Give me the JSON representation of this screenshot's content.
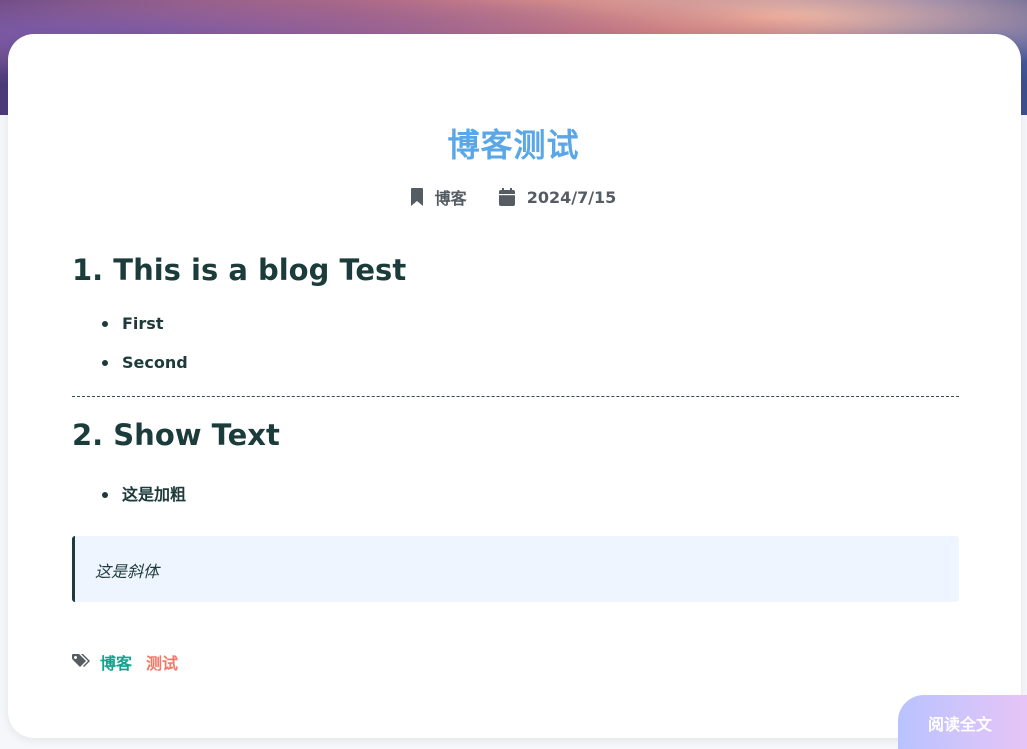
{
  "post": {
    "title": "博客测试",
    "category": "博客",
    "date": "2024/7/15",
    "sections": [
      {
        "heading": "1. This is a blog Test",
        "items": [
          "First",
          "Second"
        ]
      },
      {
        "heading": "2. Show Text",
        "items": [
          "这是加粗"
        ]
      }
    ],
    "quote": "这是斜体",
    "tags": [
      "博客",
      "测试"
    ]
  },
  "actions": {
    "read_more": "阅读全文"
  },
  "icons": {
    "category": "bookmark-icon",
    "date": "calendar-icon",
    "tags": "tags-icon"
  },
  "colors": {
    "title": "#5aa7e8",
    "tag_primary": "#12a58e",
    "tag_secondary": "#f07a6a",
    "quote_background": "#eef5ff"
  }
}
